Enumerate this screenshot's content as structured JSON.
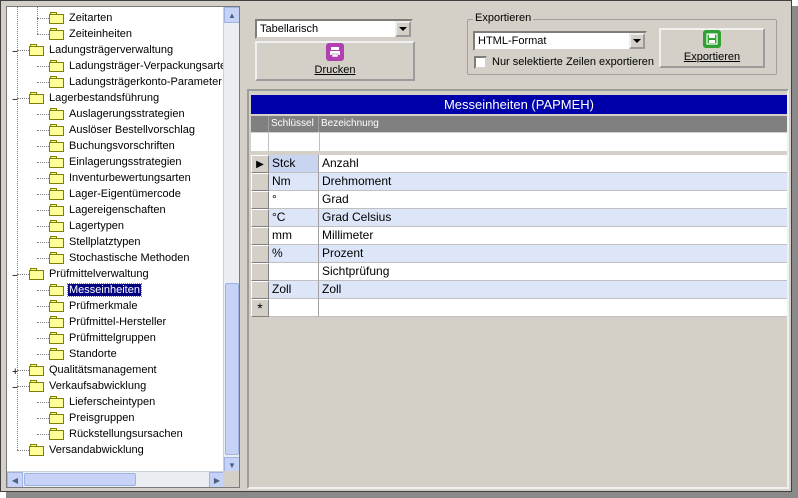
{
  "tree": {
    "items": [
      {
        "label": "Zeitarten",
        "level": 2,
        "expander": ""
      },
      {
        "label": "Zeiteinheiten",
        "level": 2,
        "expander": ""
      },
      {
        "label": "Ladungsträgerverwaltung",
        "level": 1,
        "expander": "−"
      },
      {
        "label": "Ladungsträger-Verpackungsarte",
        "level": 2,
        "expander": ""
      },
      {
        "label": "Ladungsträgerkonto-Parameter",
        "level": 2,
        "expander": ""
      },
      {
        "label": "Lagerbestandsführung",
        "level": 1,
        "expander": "−"
      },
      {
        "label": "Auslagerungsstrategien",
        "level": 2,
        "expander": ""
      },
      {
        "label": "Auslöser Bestellvorschlag",
        "level": 2,
        "expander": ""
      },
      {
        "label": "Buchungsvorschriften",
        "level": 2,
        "expander": ""
      },
      {
        "label": "Einlagerungsstrategien",
        "level": 2,
        "expander": ""
      },
      {
        "label": "Inventurbewertungsarten",
        "level": 2,
        "expander": ""
      },
      {
        "label": "Lager-Eigentümercode",
        "level": 2,
        "expander": ""
      },
      {
        "label": "Lagereigenschaften",
        "level": 2,
        "expander": ""
      },
      {
        "label": "Lagertypen",
        "level": 2,
        "expander": ""
      },
      {
        "label": "Stellplatztypen",
        "level": 2,
        "expander": ""
      },
      {
        "label": "Stochastische Methoden",
        "level": 2,
        "expander": ""
      },
      {
        "label": "Prüfmittelverwaltung",
        "level": 1,
        "expander": "−"
      },
      {
        "label": "Messeinheiten",
        "level": 2,
        "expander": "",
        "selected": true
      },
      {
        "label": "Prüfmerkmale",
        "level": 2,
        "expander": ""
      },
      {
        "label": "Prüfmittel-Hersteller",
        "level": 2,
        "expander": ""
      },
      {
        "label": "Prüfmittelgruppen",
        "level": 2,
        "expander": ""
      },
      {
        "label": "Standorte",
        "level": 2,
        "expander": ""
      },
      {
        "label": "Qualitätsmanagement",
        "level": 1,
        "expander": "+"
      },
      {
        "label": "Verkaufsabwicklung",
        "level": 1,
        "expander": "−"
      },
      {
        "label": "Lieferscheintypen",
        "level": 2,
        "expander": ""
      },
      {
        "label": "Preisgruppen",
        "level": 2,
        "expander": ""
      },
      {
        "label": "Rückstellungsursachen",
        "level": 2,
        "expander": ""
      },
      {
        "label": "Versandabwicklung",
        "level": 1,
        "expander": ""
      }
    ]
  },
  "toolbar": {
    "view_select": "Tabellarisch",
    "print_label": "Drucken",
    "export_group_title": "Exportieren",
    "format_select": "HTML-Format",
    "selected_only_label": "Nur selektierte Zeilen exportieren",
    "export_label": "Exportieren"
  },
  "grid": {
    "title": "Messeinheiten (PAPMEH)",
    "columns": [
      "Schlüssel",
      "Bezeichnung"
    ],
    "rows": [
      {
        "key": "Stck",
        "name": "Anzahl"
      },
      {
        "key": "Nm",
        "name": "Drehmoment"
      },
      {
        "key": "°",
        "name": "Grad"
      },
      {
        "key": "°C",
        "name": "Grad Celsius"
      },
      {
        "key": "mm",
        "name": "Millimeter"
      },
      {
        "key": "%",
        "name": "Prozent"
      },
      {
        "key": "",
        "name": "Sichtprüfung"
      },
      {
        "key": "Zoll",
        "name": "Zoll"
      }
    ],
    "current_row_marker": "▶",
    "new_row_marker": "*"
  },
  "colors": {
    "caption_bg": "#0000aa",
    "row_alt_bg": "#dce6f8",
    "print_icon": "#b040b0",
    "export_icon": "#30a030"
  }
}
